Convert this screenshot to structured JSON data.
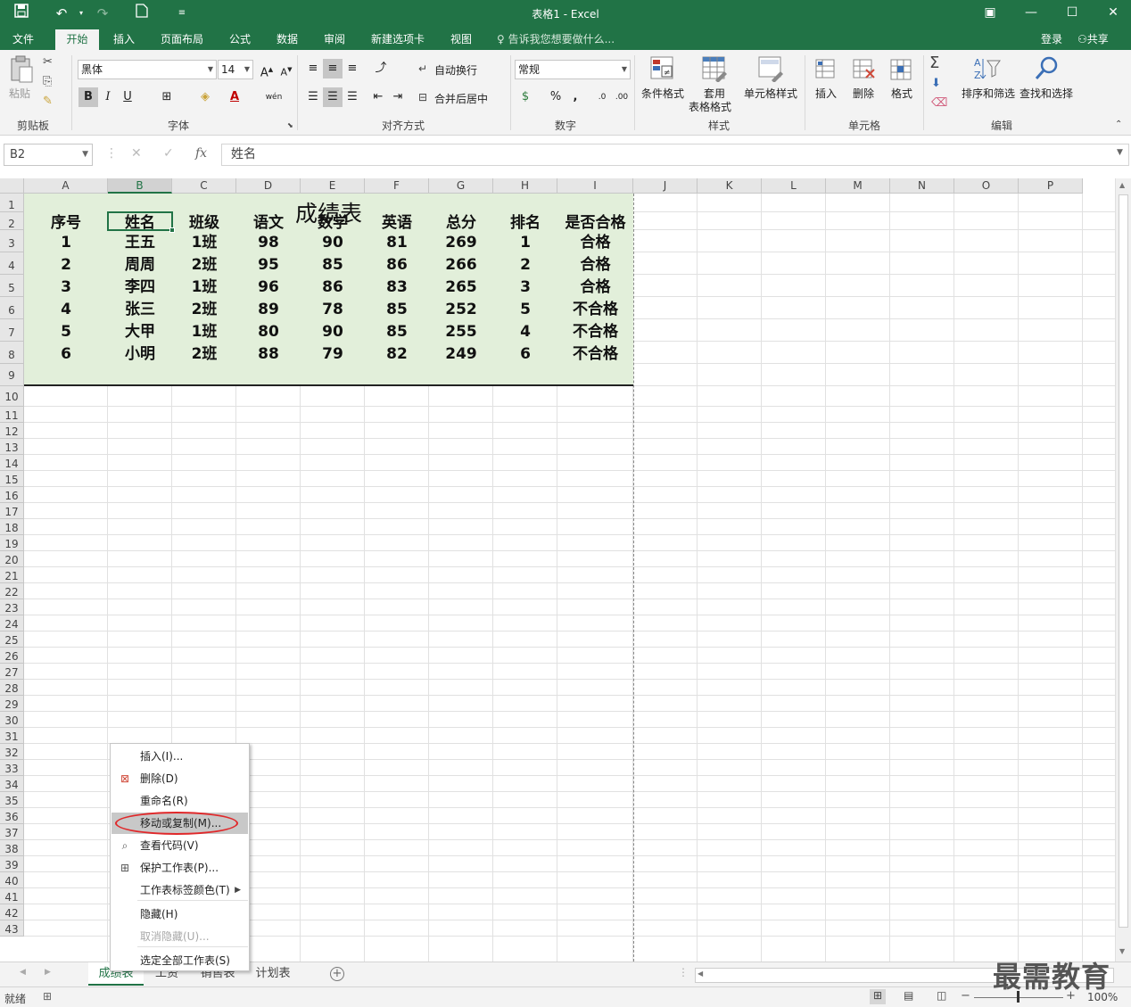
{
  "window": {
    "title": "表格1 - Excel",
    "quick_access": {
      "save_icon": "save-icon",
      "undo_icon": "undo-icon",
      "redo_icon": "redo-icon",
      "new_icon": "new-file-icon",
      "customize_icon": "customize-qat-icon"
    },
    "controls": {
      "ribbon_display": "▣",
      "minimize": "—",
      "maximize": "☐",
      "close": "✕"
    }
  },
  "ribbon_tabs": [
    "文件",
    "开始",
    "插入",
    "页面布局",
    "公式",
    "数据",
    "审阅",
    "新建选项卡",
    "视图"
  ],
  "active_tab": "开始",
  "tell_me": "告诉我您想要做什么...",
  "login": "登录",
  "share": "共享",
  "ribbon": {
    "clipboard": {
      "label": "剪贴板",
      "paste": "粘贴"
    },
    "font": {
      "label": "字体",
      "font_name": "黑体",
      "font_size": "14",
      "bold": "B",
      "italic": "I",
      "underline": "U",
      "wen": "wén"
    },
    "alignment": {
      "label": "对齐方式",
      "wrap": "自动换行",
      "merge": "合并后居中"
    },
    "number": {
      "label": "数字",
      "format": "常规",
      "percent": "%",
      "comma": ","
    },
    "styles": {
      "label": "样式",
      "conditional": "条件格式",
      "table_line1": "套用",
      "table_line2": "表格格式",
      "cell_styles": "单元格样式"
    },
    "cells": {
      "label": "单元格",
      "insert": "插入",
      "delete": "删除",
      "format": "格式"
    },
    "editing": {
      "label": "编辑",
      "sort": "排序和筛选",
      "find": "查找和选择"
    }
  },
  "formula_bar": {
    "name_box": "B2",
    "cancel": "✕",
    "enter": "✓",
    "fx": "fx",
    "formula": "姓名"
  },
  "columns": [
    "A",
    "B",
    "C",
    "D",
    "E",
    "F",
    "G",
    "H",
    "I",
    "J",
    "K",
    "L",
    "M",
    "N",
    "O",
    "P"
  ],
  "rows": [
    "1",
    "2",
    "3",
    "4",
    "5",
    "6",
    "7",
    "8",
    "9",
    "10",
    "11",
    "12",
    "13",
    "14",
    "15",
    "16",
    "17",
    "18",
    "19",
    "20",
    "21",
    "22",
    "23",
    "24",
    "25",
    "26",
    "27",
    "28",
    "29",
    "30",
    "31",
    "32",
    "33",
    "34",
    "35",
    "36",
    "37",
    "38",
    "39",
    "40",
    "41",
    "42",
    "43"
  ],
  "sheet": {
    "title": "成绩表",
    "headers": [
      "序号",
      "姓名",
      "班级",
      "语文",
      "数学",
      "英语",
      "总分",
      "排名",
      "是否合格"
    ],
    "data": [
      [
        "1",
        "王五",
        "1班",
        "98",
        "90",
        "81",
        "269",
        "1",
        "合格"
      ],
      [
        "2",
        "周周",
        "2班",
        "95",
        "85",
        "86",
        "266",
        "2",
        "合格"
      ],
      [
        "3",
        "李四",
        "1班",
        "96",
        "86",
        "83",
        "265",
        "3",
        "合格"
      ],
      [
        "4",
        "张三",
        "2班",
        "89",
        "78",
        "85",
        "252",
        "5",
        "不合格"
      ],
      [
        "5",
        "大甲",
        "1班",
        "80",
        "90",
        "85",
        "255",
        "4",
        "不合格"
      ],
      [
        "6",
        "小明",
        "2班",
        "88",
        "79",
        "82",
        "249",
        "6",
        "不合格"
      ]
    ],
    "fill_color": "#e2efda"
  },
  "context_menu": {
    "items": [
      {
        "label": "插入(I)...",
        "icon": "",
        "disabled": false
      },
      {
        "label": "删除(D)",
        "icon": "delete-sheet-icon",
        "disabled": false
      },
      {
        "label": "重命名(R)",
        "icon": "",
        "disabled": false
      },
      {
        "label": "移动或复制(M)...",
        "icon": "",
        "disabled": false,
        "highlighted": true
      },
      {
        "label": "查看代码(V)",
        "icon": "view-code-icon",
        "disabled": false
      },
      {
        "label": "保护工作表(P)...",
        "icon": "protect-sheet-icon",
        "disabled": false
      },
      {
        "label": "工作表标签颜色(T)",
        "icon": "",
        "disabled": false,
        "submenu": true
      },
      {
        "label": "隐藏(H)",
        "icon": "",
        "disabled": false
      },
      {
        "label": "取消隐藏(U)...",
        "icon": "",
        "disabled": true
      },
      {
        "label": "选定全部工作表(S)",
        "icon": "",
        "disabled": false
      }
    ]
  },
  "sheet_tabs": [
    "成绩表",
    "工资",
    "销售表",
    "计划表"
  ],
  "active_sheet": "成绩表",
  "status": {
    "ready": "就绪",
    "zoom": "100%"
  },
  "watermark": "最需教育",
  "colors": {
    "excel_green": "#217346",
    "highlight_oval": "#e0282a"
  }
}
